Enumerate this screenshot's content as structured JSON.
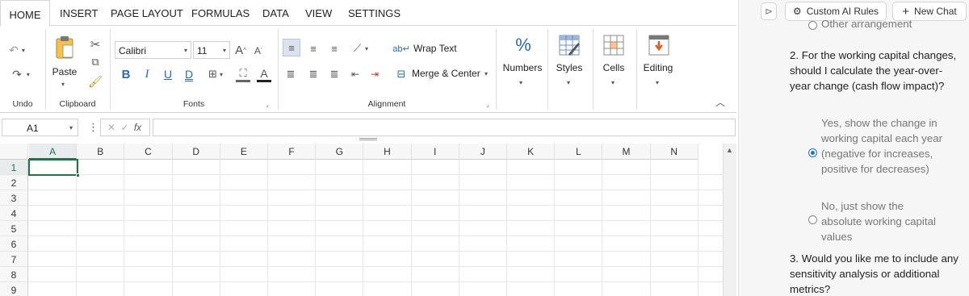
{
  "ribbon_tabs": [
    "HOME",
    "INSERT",
    "PAGE LAYOUT",
    "FORMULAS",
    "DATA",
    "VIEW",
    "SETTINGS"
  ],
  "active_tab": "HOME",
  "groups": {
    "undo": "Undo",
    "clipboard": "Clipboard",
    "paste": "Paste",
    "font": "Fonts",
    "alignment": "Alignment",
    "numbers": "Numbers",
    "styles": "Styles",
    "cells": "Cells",
    "editing": "Editing"
  },
  "font": {
    "name": "Calibri",
    "size": "11",
    "bold": "B",
    "italic": "I",
    "underline": "U",
    "dbl_underline": "D",
    "grow": "A",
    "shrink": "A",
    "color": "A"
  },
  "alignment": {
    "wrap_text": "Wrap Text",
    "merge_center": "Merge & Center"
  },
  "formula_bar": {
    "cell_ref": "A1",
    "fx": "fx",
    "value": ""
  },
  "columns": [
    "A",
    "B",
    "C",
    "D",
    "E",
    "F",
    "G",
    "H",
    "I",
    "J",
    "K",
    "L",
    "M",
    "N"
  ],
  "rows": [
    "1",
    "2",
    "3",
    "4",
    "5",
    "6",
    "7",
    "8",
    "9"
  ],
  "selected_cell": "A1",
  "chat": {
    "custom_rules": "Custom AI Rules",
    "new_chat": "New Chat",
    "prev_option_partial": "Other arrangement",
    "q2": "2. For the working capital changes, should I calculate the year-over-year change (cash flow impact)?",
    "q2_opt1": "Yes, show the change in working capital each year (negative for increases, positive for decreases)",
    "q2_opt1_selected": true,
    "q2_opt2": "No, just show the absolute working capital values",
    "q2_opt2_selected": false,
    "q3": "3. Would you like me to include any sensitivity analysis or additional metrics?"
  },
  "colors": {
    "accent_green": "#217346",
    "radio_blue": "#1f6fd1",
    "align_active_bg": "#dce3ee",
    "icon_blue": "#2b6cb0"
  }
}
